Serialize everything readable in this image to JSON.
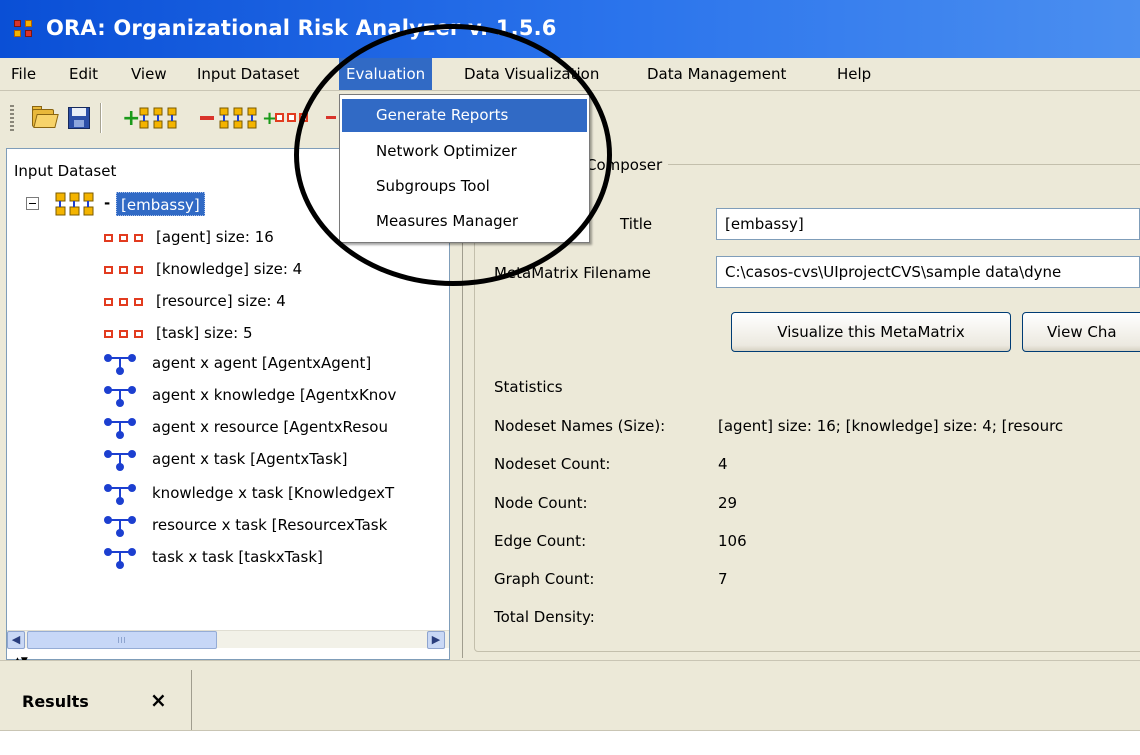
{
  "window": {
    "title": "ORA: Organizational Risk Analyzer v. 1.5.6"
  },
  "menubar": {
    "items": [
      "File",
      "Edit",
      "View",
      "Input Dataset",
      "Evaluation",
      "Data Visualization",
      "Data Management",
      "Help"
    ],
    "active": "Evaluation"
  },
  "evaluation_menu": {
    "items": [
      "Generate Reports",
      "Network Optimizer",
      "Subgroups Tool",
      "Measures Manager"
    ],
    "selected": "Generate Reports"
  },
  "toolbar": {
    "icons": [
      "open-folder-icon",
      "save-disk-icon",
      "add-metamatrix-icon",
      "remove-metamatrix-icon",
      "add-nodeset-icon",
      "remove-nodeset-icon"
    ]
  },
  "input_dataset": {
    "header": "Input Dataset",
    "root": "[embassy]",
    "root_prefix": "-",
    "nodesets": [
      "[agent] size: 16",
      "[knowledge] size: 4",
      "[resource] size: 4",
      "[task] size: 5"
    ],
    "networks": [
      "agent x agent [AgentxAgent]",
      "agent x knowledge [AgentxKnov",
      "agent x resource [AgentxResou",
      "agent x task [AgentxTask]",
      "knowledge x task [KnowledgexT",
      "resource x task [ResourcexTask",
      "task x task [taskxTask]"
    ]
  },
  "composer": {
    "legend": "Composer",
    "title_label": "Title",
    "title_value": "[embassy]",
    "filename_label": "MetaMatrix Filename",
    "filename_value": "C:\\casos-cvs\\UIprojectCVS\\sample data\\dyne",
    "visualize_button": "Visualize this MetaMatrix",
    "view_button": "View Cha",
    "statistics_header": "Statistics",
    "stats": [
      {
        "label": "Nodeset Names (Size):",
        "value": "[agent] size: 16; [knowledge] size: 4; [resourc"
      },
      {
        "label": "Nodeset Count:",
        "value": "4"
      },
      {
        "label": "Node Count:",
        "value": "29"
      },
      {
        "label": "Edge Count:",
        "value": "106"
      },
      {
        "label": "Graph Count:",
        "value": "7"
      },
      {
        "label": "Total Density:",
        "value": ""
      }
    ]
  },
  "results": {
    "tab_label": "Results",
    "close_glyph": "×"
  },
  "colors": {
    "selection": "#316ac5",
    "titlebar": "#0a4fd6",
    "nodeset_icon": "#e23b1f",
    "network_icon": "#1c3fd0"
  }
}
